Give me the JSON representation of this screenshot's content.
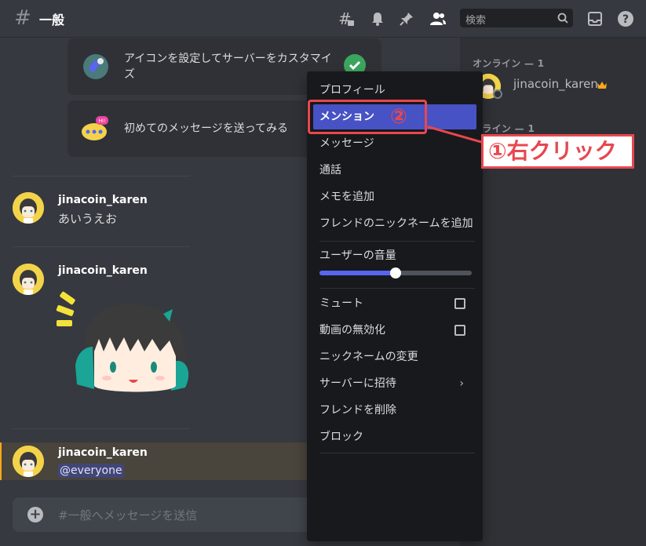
{
  "header": {
    "hash": "#",
    "channel_name": "一般",
    "search_placeholder": "検索"
  },
  "members": {
    "online_header": "オンライン — 1",
    "offline_header": "フライン — 1",
    "member_name": "jinacoin_karen"
  },
  "chat": {
    "cards": [
      {
        "text_line1": "アイコンを設定してサーバーをカスタマイ",
        "text_line2": "ズ"
      },
      {
        "text": "初めてのメッセージを送ってみる"
      }
    ],
    "messages": [
      {
        "user": "jinacoin_karen",
        "text": "あいうえお"
      },
      {
        "user": "jinacoin_karen",
        "text": ""
      },
      {
        "user": "jinacoin_karen",
        "text": "@everyone"
      }
    ],
    "composer_placeholder": "#一般へメッセージを送信"
  },
  "context_menu": {
    "items": [
      "プロフィール",
      "メンション",
      "メッセージ",
      "通話",
      "メモを追加",
      "フレンドのニックネームを追加",
      "ユーザーの音量",
      "ミュート",
      "動画の無効化",
      "ニックネームの変更",
      "サーバーに招待",
      "フレンドを削除",
      "ブロック"
    ],
    "volume_level": 0.5,
    "submenu_arrow": "›"
  },
  "annotations": {
    "step1": "①右クリック",
    "step2": "②"
  },
  "colors": {
    "accent": "#5865f2",
    "menu_active": "#4752c4",
    "annotation": "#e8474f",
    "online": "#3ba55d",
    "mention_highlight": "#faa81a"
  }
}
